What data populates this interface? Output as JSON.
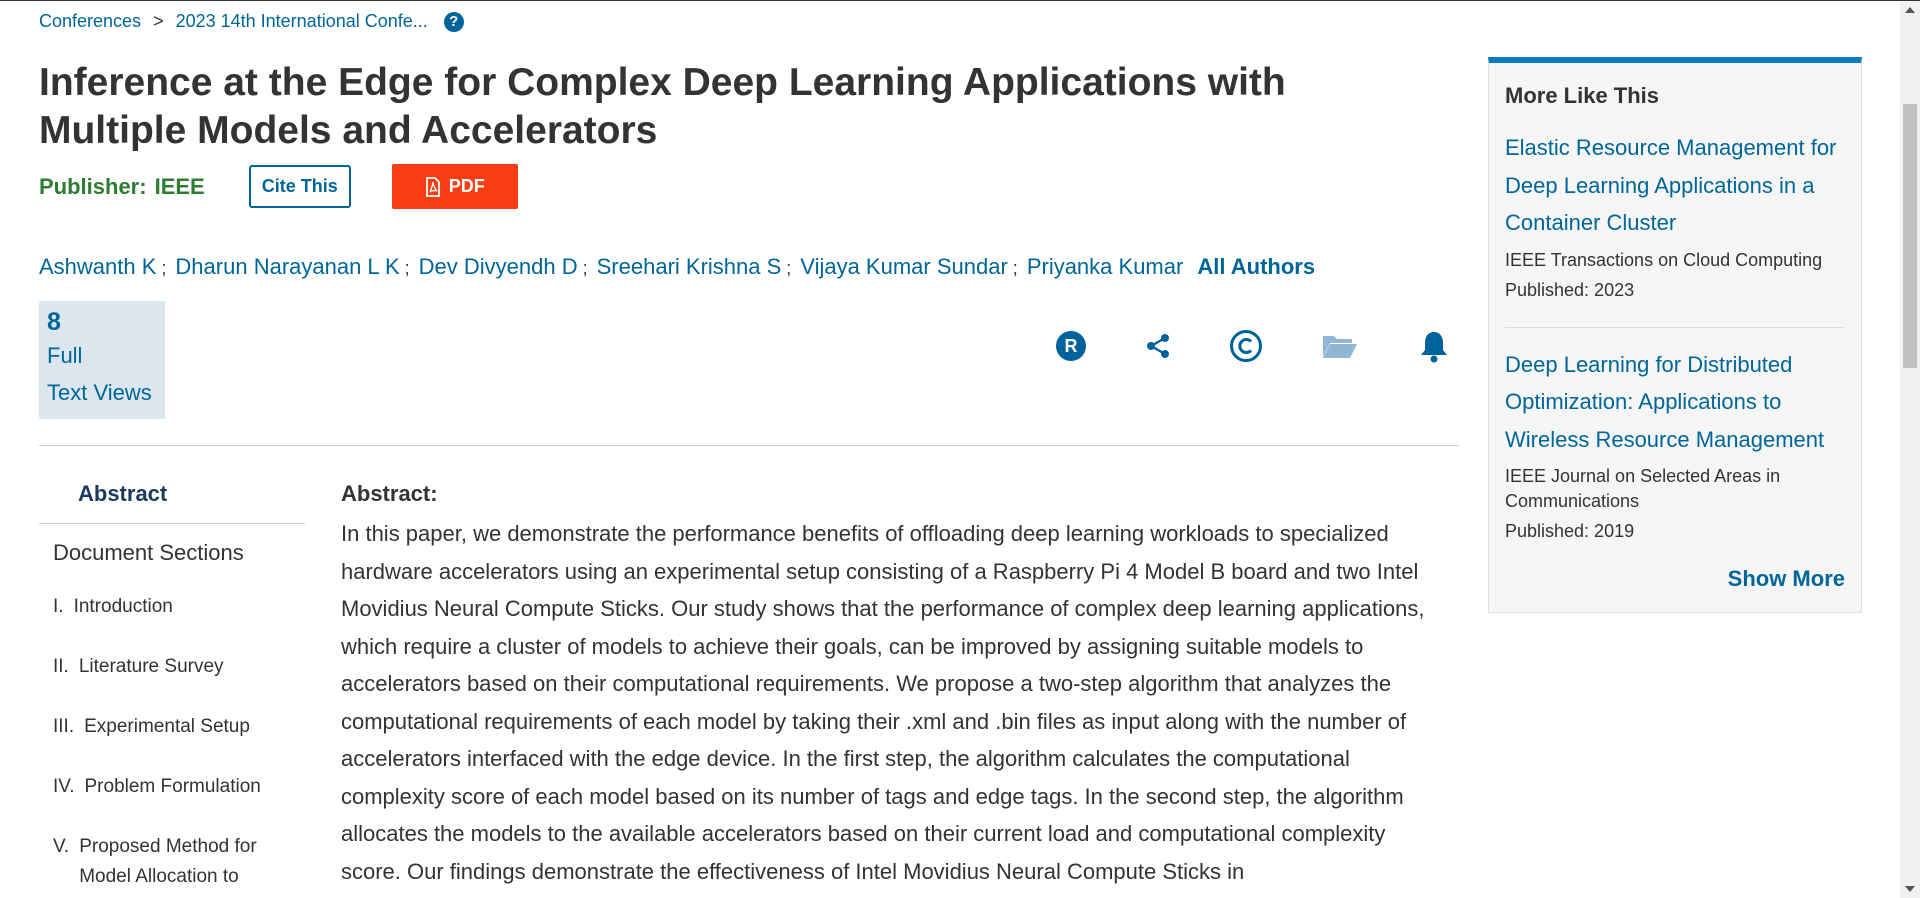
{
  "breadcrumb": {
    "items": [
      "Conferences",
      "2023 14th International Confe..."
    ],
    "separator": ">",
    "help_icon": "question-circle-icon"
  },
  "title": "Inference at the Edge for Complex Deep Learning Applications with Multiple Models and Accelerators",
  "publisher": {
    "label": "Publisher:",
    "name": "IEEE"
  },
  "buttons": {
    "cite": "Cite This",
    "pdf": "PDF"
  },
  "authors": {
    "list": [
      "Ashwanth K",
      "Dharun Narayanan L K",
      "Dev Divyendh D",
      "Sreehari Krishna S",
      "Vijaya Kumar Sundar",
      "Priyanka Kumar"
    ],
    "separator": ";",
    "all_label": "All Authors"
  },
  "views": {
    "count": "8",
    "line1": "Full",
    "line2": "Text Views"
  },
  "toolbar_icons": [
    "rights-icon",
    "share-icon",
    "copyright-icon",
    "folder-icon",
    "bell-icon"
  ],
  "nav": {
    "abstract": "Abstract",
    "sections_title": "Document Sections",
    "sections": [
      {
        "num": "I.",
        "label": "Introduction"
      },
      {
        "num": "II.",
        "label": "Literature Survey"
      },
      {
        "num": "III.",
        "label": "Experimental Setup"
      },
      {
        "num": "IV.",
        "label": "Problem Formulation"
      },
      {
        "num": "V.",
        "label": "Proposed Method for Model Allocation to"
      }
    ]
  },
  "abstract": {
    "heading": "Abstract:",
    "text": "In this paper, we demonstrate the performance benefits of offloading deep learning workloads to specialized hardware accelerators using an experimental setup consisting of a Raspberry Pi 4 Model B board and two Intel Movidius Neural Compute Sticks. Our study shows that the performance of complex deep learning applications, which require a cluster of models to achieve their goals, can be improved by assigning suitable models to accelerators based on their computational requirements. We propose a two-step algorithm that analyzes the computational requirements of each model by taking their .xml and .bin files as input along with the number of accelerators interfaced with the edge device. In the first step, the algorithm calculates the computational complexity score of each model based on its number of tags and edge tags. In the second step, the algorithm allocates the models to the available accelerators based on their current load and computational complexity score. Our findings demonstrate the effectiveness of Intel Movidius Neural Compute Sticks in"
  },
  "more_like_this": {
    "title": "More Like This",
    "items": [
      {
        "title": "Elastic Resource Management for Deep Learning Applications in a Container Cluster",
        "source": "IEEE Transactions on Cloud Computing",
        "published": "Published: 2023"
      },
      {
        "title": "Deep Learning for Distributed Optimization: Applications to Wireless Resource Management",
        "source": "IEEE Journal on Selected Areas in Communications",
        "published": "Published: 2019"
      }
    ],
    "show_more": "Show More"
  },
  "colors": {
    "link": "#006699",
    "publisher": "#2e7d32",
    "pdf_button": "#fa3c12",
    "sidebar_accent": "#0a7bc1",
    "views_bg": "#dce6ee"
  }
}
